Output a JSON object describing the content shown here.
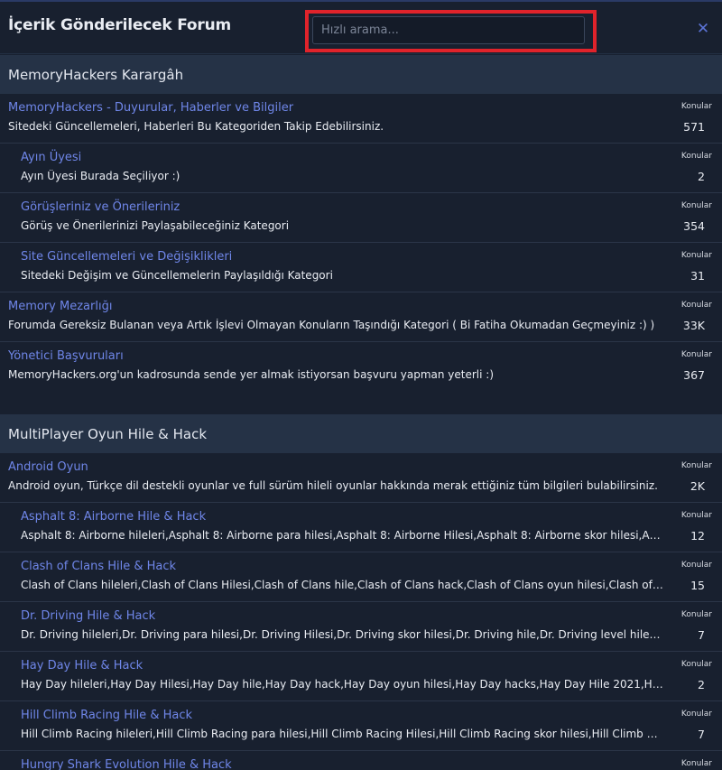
{
  "header": {
    "title": "İçerik Gönderilecek Forum",
    "search_placeholder": "Hızlı arama..."
  },
  "categories": [
    {
      "title": "MemoryHackers Karargâh",
      "forums": [
        {
          "name": "MemoryHackers - Duyurular, Haberler ve Bilgiler",
          "desc": "Sitedeki Güncellemeleri, Haberleri Bu Kategoriden Takip Edebilirsiniz.",
          "stat_label": "Konular",
          "stat_value": "571",
          "level": 0
        },
        {
          "name": "Ayın Üyesi",
          "desc": "Ayın Üyesi Burada Seçiliyor :)",
          "stat_label": "Konular",
          "stat_value": "2",
          "level": 1
        },
        {
          "name": "Görüşleriniz ve Önerileriniz",
          "desc": "Görüş ve Önerilerinizi Paylaşabileceğiniz Kategori",
          "stat_label": "Konular",
          "stat_value": "354",
          "level": 1
        },
        {
          "name": "Site Güncellemeleri ve Değişiklikleri",
          "desc": "Sitedeki Değişim ve Güncellemelerin Paylaşıldığı Kategori",
          "stat_label": "Konular",
          "stat_value": "31",
          "level": 1
        },
        {
          "name": "Memory Mezarlığı",
          "desc": "Forumda Gereksiz Bulanan veya Artık İşlevi Olmayan Konuların Taşındığı Kategori ( Bi Fatiha Okumadan Geçmeyiniz :) )",
          "stat_label": "Konular",
          "stat_value": "33K",
          "level": 0
        },
        {
          "name": "Yönetici Başvuruları",
          "desc": "MemoryHackers.org'un kadrosunda sende yer almak istiyorsan başvuru yapman yeterli :)",
          "stat_label": "Konular",
          "stat_value": "367",
          "level": 0
        }
      ]
    },
    {
      "title": "MultiPlayer Oyun Hile & Hack",
      "forums": [
        {
          "name": "Android Oyun",
          "desc": "Android oyun, Türkçe dil destekli oyunlar ve full sürüm hileli oyunlar hakkında merak ettiğiniz tüm bilgileri bulabilirsiniz.",
          "stat_label": "Konular",
          "stat_value": "2K",
          "level": 0
        },
        {
          "name": "Asphalt 8: Airborne Hile & Hack",
          "desc": "Asphalt 8: Airborne hileleri,Asphalt 8: Airborne para hilesi,Asphalt 8: Airborne Hilesi,Asphalt 8: Airborne skor hilesi,Asphalt 8...",
          "stat_label": "Konular",
          "stat_value": "12",
          "level": 1
        },
        {
          "name": "Clash of Clans Hile & Hack",
          "desc": "Clash of Clans hileleri,Clash of Clans Hilesi,Clash of Clans hile,Clash of Clans hack,Clash of Clans oyun hilesi,Clash of Clans h...",
          "stat_label": "Konular",
          "stat_value": "15",
          "level": 1
        },
        {
          "name": "Dr. Driving Hile & Hack",
          "desc": "Dr. Driving hileleri,Dr. Driving para hilesi,Dr. Driving Hilesi,Dr. Driving skor hilesi,Dr. Driving hile,Dr. Driving level hilesi,Dr. Driv...",
          "stat_label": "Konular",
          "stat_value": "7",
          "level": 1
        },
        {
          "name": "Hay Day Hile & Hack",
          "desc": "Hay Day hileleri,Hay Day Hilesi,Hay Day hile,Hay Day hack,Hay Day oyun hilesi,Hay Day hacks,Hay Day Hile 2021,Hay Day hi...",
          "stat_label": "Konular",
          "stat_value": "2",
          "level": 1
        },
        {
          "name": "Hill Climb Racing Hile & Hack",
          "desc": "Hill Climb Racing hileleri,Hill Climb Racing para hilesi,Hill Climb Racing Hilesi,Hill Climb Racing skor hilesi,Hill Climb Racing ...",
          "stat_label": "Konular",
          "stat_value": "7",
          "level": 1
        },
        {
          "name": "Hungry Shark Evolution Hile & Hack",
          "desc": "",
          "stat_label": "Konular",
          "stat_value": "",
          "level": 1
        }
      ]
    }
  ],
  "icons": {
    "close": "close-icon"
  },
  "colors": {
    "background": "#18202f",
    "category_header": "#253246",
    "link": "#6f86e8",
    "highlight": "#e0232b",
    "close": "#5b73d6"
  }
}
